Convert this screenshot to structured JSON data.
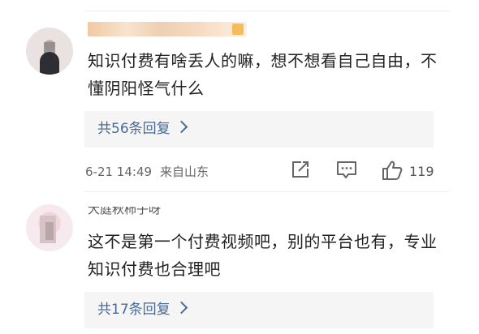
{
  "comments": [
    {
      "text": "知识付费有啥丢人的嘛，想不想看自己自由，不懂阴阳怪气什么",
      "reply_link": "共56条回复",
      "date": "6-21 14:49",
      "location": "来自山东",
      "likes": "119"
    },
    {
      "user_name": "大庭秋柿子呀",
      "text": "这不是第一个付费视频吧，别的平台也有，专业知识付费也合理吧",
      "reply_link": "共17条回复"
    }
  ],
  "icons": [
    "share-icon",
    "comment-icon",
    "like-icon",
    "chevron-right-icon"
  ],
  "colors": {
    "link": "#4a6a96",
    "reply_bg": "#f5f5f5",
    "meta_text": "#666666"
  }
}
